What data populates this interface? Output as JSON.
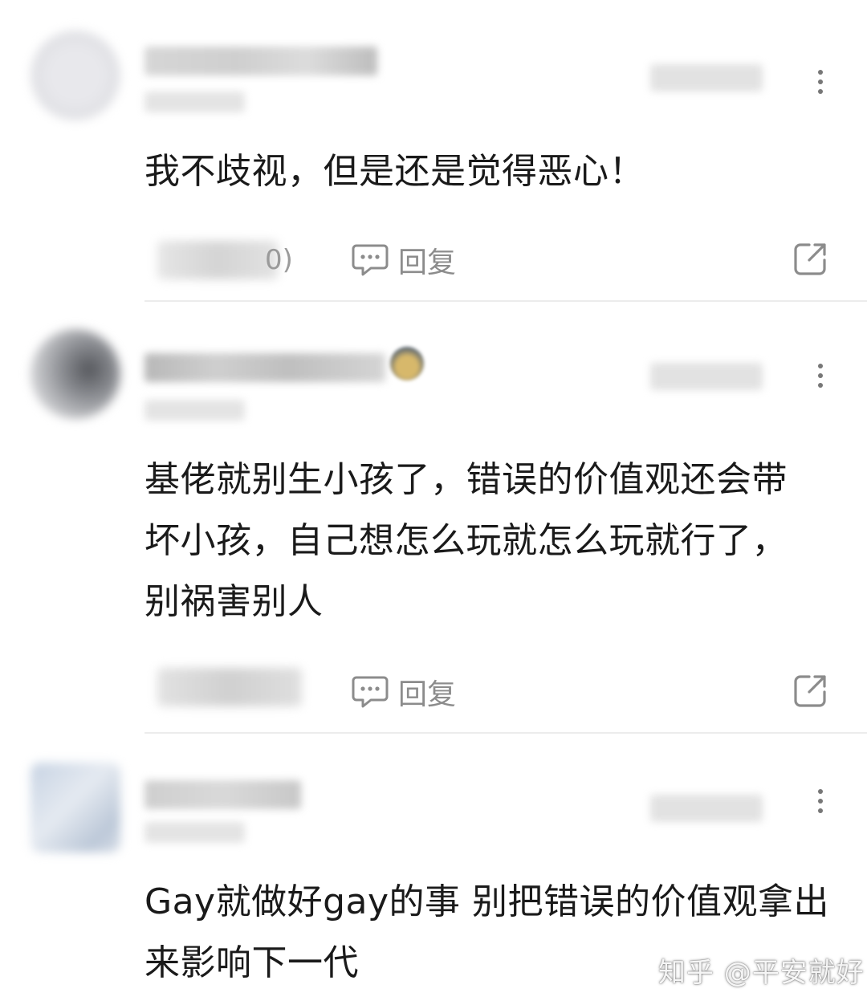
{
  "comments": [
    {
      "text": "我不歧视，但是还是觉得恶心！",
      "like_count_fragment": "0)",
      "reply_label": "回复"
    },
    {
      "text": "基佬就别生小孩了，错误的价值观还会带坏小孩，自己想怎么玩就怎么玩就行了，别祸害别人",
      "reply_label": "回复"
    },
    {
      "text": "Gay就做好gay的事 别把错误的价值观拿出来影响下一代"
    }
  ],
  "icons": {
    "more": "more-vertical-icon",
    "reply": "chat-bubble-icon",
    "share": "share-icon"
  },
  "colors": {
    "text": "#1a1a1a",
    "secondary": "#8c8c8c",
    "divider": "#ececec"
  },
  "watermark": "知乎 @平安就好"
}
